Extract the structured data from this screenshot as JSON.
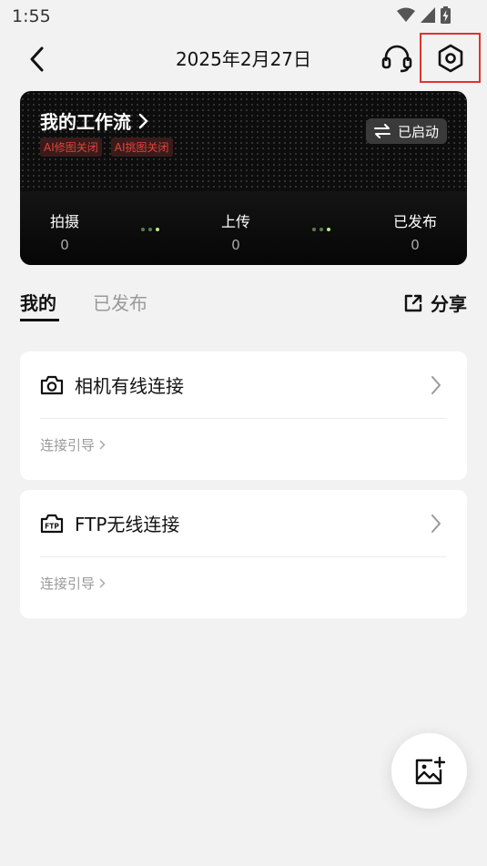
{
  "status_bar": {
    "time": "1:55",
    "icons": [
      "wifi-icon",
      "signal-icon",
      "battery-charging-icon"
    ]
  },
  "header": {
    "title": "2025年2月27日",
    "icons": [
      "back-arrow-icon",
      "headset-icon",
      "settings-hexagon-icon"
    ],
    "highlight_color": "#e0332d"
  },
  "workflow": {
    "title": "我的工作流",
    "tags": [
      "AI修图关闭",
      "AI挑图关闭"
    ],
    "status": "已启动",
    "stages": [
      {
        "label": "拍摄",
        "count": "0"
      },
      {
        "label": "上传",
        "count": "0"
      },
      {
        "label": "已发布",
        "count": "0"
      }
    ],
    "accent_color": "#b8f07a",
    "tag_color": "#e2453a"
  },
  "tabs": {
    "items": [
      "我的",
      "已发布"
    ],
    "active": "我的",
    "share_label": "分享"
  },
  "connections": [
    {
      "title": "相机有线连接",
      "icon": "camera-icon",
      "guide": "连接引导"
    },
    {
      "title": "FTP无线连接",
      "icon": "ftp-icon",
      "icon_text": "FTP",
      "guide": "连接引导"
    }
  ],
  "fab": {
    "icon": "add-image-icon"
  }
}
